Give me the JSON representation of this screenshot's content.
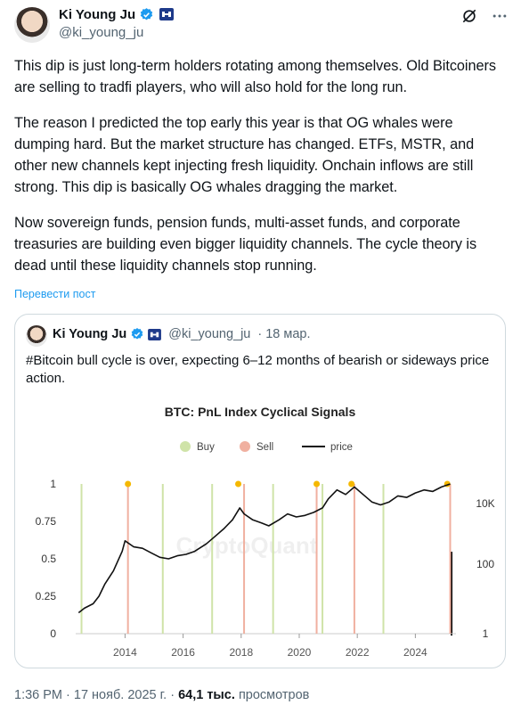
{
  "author": {
    "name": "Ki Young Ju",
    "handle": "@ki_young_ju"
  },
  "tweet": {
    "paragraphs": [
      "This dip is just long-term holders rotating among themselves. Old Bitcoiners are selling to tradfi players, who will also hold for the long run.",
      "The reason I predicted the top early this year is that OG whales were dumping hard. But the market structure has changed. ETFs, MSTR, and other new channels kept injecting fresh liquidity. Onchain inflows are still strong. This dip is basically OG whales dragging the market.",
      "Now sovereign funds, pension funds, multi-asset funds, and corporate treasuries are building even bigger liquidity channels. The cycle theory is dead until these liquidity channels stop running."
    ],
    "translate_label": "Перевести пост"
  },
  "quote": {
    "name": "Ki Young Ju",
    "handle": "@ki_young_ju",
    "separator": "·",
    "date": "18 мар.",
    "text": "#Bitcoin bull cycle is over, expecting 6–12 months of bearish or sideways price action."
  },
  "chart_data": {
    "type": "line",
    "title": "BTC: PnL Index Cyclical Signals",
    "watermark": "CryptoQuant",
    "legend": [
      {
        "name": "Buy",
        "color": "#cfe3a8"
      },
      {
        "name": "Sell",
        "color": "#f0b0a0"
      },
      {
        "name": "price",
        "color": "#111111"
      }
    ],
    "legend_placement": "top-center",
    "x_ticks": [
      "2014",
      "2016",
      "2018",
      "2020",
      "2022",
      "2024"
    ],
    "y_left_ticks": [
      "0",
      "0.25",
      "0.5",
      "0.75",
      "1"
    ],
    "y_right_ticks": [
      "1",
      "100",
      "10K"
    ],
    "y_right_scale": "log",
    "grid": false,
    "buy_signals_year": [
      2012.5,
      2015.3,
      2017.0,
      2019.1,
      2020.8,
      2022.9
    ],
    "sell_signals_year": [
      2014.1,
      2018.1,
      2020.6,
      2021.9,
      2025.2
    ],
    "top_markers_year": [
      2014.1,
      2017.9,
      2020.6,
      2021.8,
      2025.1
    ],
    "price_series": {
      "name": "price",
      "x": [
        2012.4,
        2012.6,
        2012.9,
        2013.1,
        2013.3,
        2013.6,
        2013.9,
        2014.0,
        2014.3,
        2014.6,
        2014.9,
        2015.2,
        2015.5,
        2015.8,
        2016.1,
        2016.4,
        2016.8,
        2017.1,
        2017.4,
        2017.7,
        2017.95,
        2018.1,
        2018.4,
        2018.7,
        2018.95,
        2019.3,
        2019.6,
        2019.9,
        2020.2,
        2020.5,
        2020.8,
        2021.0,
        2021.3,
        2021.6,
        2021.9,
        2022.2,
        2022.5,
        2022.8,
        2023.1,
        2023.4,
        2023.7,
        2024.0,
        2024.3,
        2024.6,
        2024.9,
        2025.2
      ],
      "y": [
        0.14,
        0.17,
        0.2,
        0.25,
        0.33,
        0.42,
        0.55,
        0.62,
        0.58,
        0.57,
        0.54,
        0.51,
        0.5,
        0.52,
        0.53,
        0.55,
        0.6,
        0.65,
        0.7,
        0.76,
        0.84,
        0.8,
        0.76,
        0.74,
        0.72,
        0.76,
        0.8,
        0.78,
        0.79,
        0.81,
        0.84,
        0.9,
        0.96,
        0.93,
        0.98,
        0.93,
        0.88,
        0.86,
        0.88,
        0.92,
        0.91,
        0.94,
        0.96,
        0.95,
        0.98,
        1.0
      ]
    }
  },
  "footer": {
    "time_date": "1:36 PM · 17 нояб. 2025 г.",
    "dot": "·",
    "views_count": "64,1 тыс.",
    "views_label": "просмотров"
  }
}
